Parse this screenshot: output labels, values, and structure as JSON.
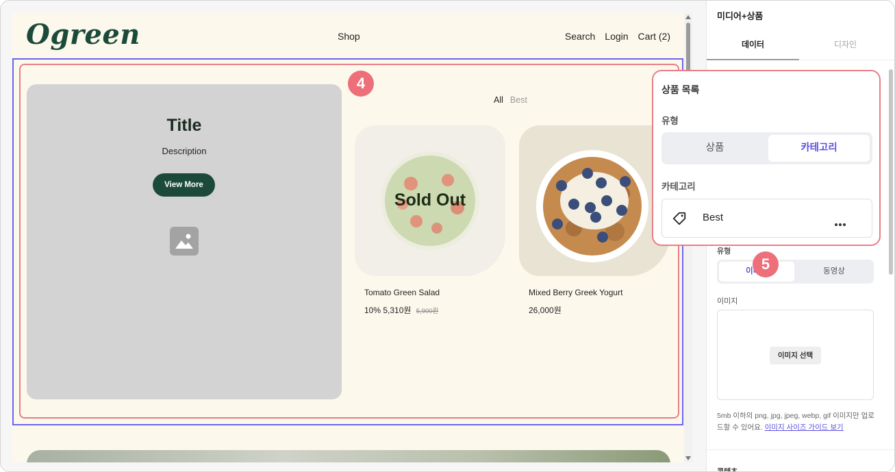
{
  "preview": {
    "logo": "Ogreen",
    "nav": {
      "shop": "Shop",
      "search": "Search",
      "login": "Login",
      "cart": "Cart (2)"
    },
    "hero": {
      "title": "Title",
      "description": "Description",
      "button": "View More",
      "image_icon": "image-placeholder-icon"
    },
    "step_badge": "4",
    "filters": {
      "all": "All",
      "best": "Best"
    },
    "products": [
      {
        "name": "Tomato Green Salad",
        "discount": "10%",
        "price": "5,310원",
        "original_price": "5,900원",
        "status": "Sold Out"
      },
      {
        "name": "Mixed Berry Greek Yogurt",
        "price": "26,000원"
      }
    ]
  },
  "panel": {
    "title": "미디어+상품",
    "tabs": {
      "data": "데이터",
      "design": "디자인"
    },
    "type_label": "유형",
    "media_types": {
      "image": "이미지",
      "video": "동영상"
    },
    "image_label": "이미지",
    "select_image_button": "이미지 선택",
    "help_text": "5mb 이하의 png, jpg, jpeg, webp, gif 이미지만 업로드할 수 있어요.",
    "help_link": "이미지 사이즈 가이드 보기",
    "content_label": "콘텐츠",
    "step_badge": "5"
  },
  "popover": {
    "title": "상품 목록",
    "type_label": "유형",
    "type_options": {
      "product": "상품",
      "category": "카테고리"
    },
    "category_label": "카테고리",
    "category_value": "Best",
    "category_icon": "tag-icon",
    "menu_icon": "more-horizontal-icon"
  },
  "colors": {
    "brand": "#1c4a3a",
    "accent": "#5a4fe0",
    "highlight": "#e97d86",
    "badge": "#ec6f7a",
    "selection": "#6b63f0"
  }
}
